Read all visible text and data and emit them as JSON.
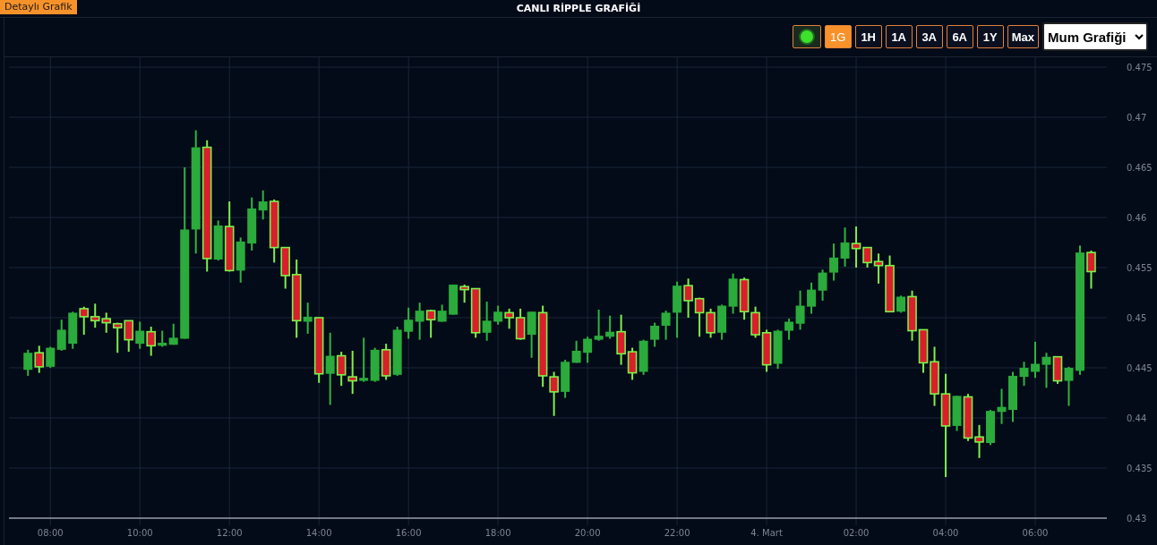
{
  "header": {
    "badge": "Detaylı Grafik",
    "title": "CANLI RİPPLE GRAFİĞİ"
  },
  "toolbar": {
    "live": {
      "on": true
    },
    "ranges": [
      {
        "label": "1G",
        "selected": true
      },
      {
        "label": "1H",
        "selected": false
      },
      {
        "label": "1A",
        "selected": false
      },
      {
        "label": "3A",
        "selected": false
      },
      {
        "label": "6A",
        "selected": false
      },
      {
        "label": "1Y",
        "selected": false
      },
      {
        "label": "Max",
        "selected": false
      }
    ],
    "chart_type": "Mum Grafiği"
  },
  "chart_data": {
    "type": "candlestick",
    "grid": true,
    "ylim": [
      0.43,
      0.475
    ],
    "yticks": [
      0.43,
      0.435,
      0.44,
      0.445,
      0.45,
      0.455,
      0.46,
      0.465,
      0.47,
      0.475
    ],
    "categories": [
      null,
      null,
      "08:00",
      null,
      null,
      null,
      null,
      null,
      null,
      null,
      "10:00",
      null,
      null,
      null,
      null,
      null,
      null,
      null,
      "12:00",
      null,
      null,
      null,
      null,
      null,
      null,
      null,
      "14:00",
      null,
      null,
      null,
      null,
      null,
      null,
      null,
      "16:00",
      null,
      null,
      null,
      null,
      null,
      null,
      null,
      "18:00",
      null,
      null,
      null,
      null,
      null,
      null,
      null,
      "20:00",
      null,
      null,
      null,
      null,
      null,
      null,
      null,
      "22:00",
      null,
      null,
      null,
      null,
      null,
      null,
      null,
      "4. Mart",
      null,
      null,
      null,
      null,
      null,
      null,
      null,
      "02:00",
      null,
      null,
      null,
      null,
      null,
      null,
      null,
      "04:00",
      null,
      null,
      null,
      null,
      null,
      null,
      null,
      "06:00",
      null,
      null,
      null,
      null,
      null
    ],
    "ohlc": [
      [
        0.4448,
        0.4468,
        0.4442,
        0.4465
      ],
      [
        0.4465,
        0.4472,
        0.4445,
        0.4451
      ],
      [
        0.4451,
        0.4471,
        0.445,
        0.447
      ],
      [
        0.4468,
        0.4498,
        0.4467,
        0.4488
      ],
      [
        0.4474,
        0.4506,
        0.4469,
        0.4505
      ],
      [
        0.4509,
        0.4511,
        0.4483,
        0.4501
      ],
      [
        0.4501,
        0.4514,
        0.449,
        0.4497
      ],
      [
        0.4499,
        0.4505,
        0.4485,
        0.4495
      ],
      [
        0.4494,
        0.4495,
        0.4465,
        0.449
      ],
      [
        0.4497,
        0.4497,
        0.4466,
        0.4478
      ],
      [
        0.4474,
        0.4496,
        0.4469,
        0.4487
      ],
      [
        0.4486,
        0.4491,
        0.4462,
        0.4472
      ],
      [
        0.4472,
        0.4487,
        0.4471,
        0.4475
      ],
      [
        0.4473,
        0.4494,
        0.4473,
        0.448
      ],
      [
        0.4479,
        0.465,
        0.4479,
        0.4588
      ],
      [
        0.4588,
        0.4687,
        0.4564,
        0.467
      ],
      [
        0.467,
        0.4677,
        0.4546,
        0.4559
      ],
      [
        0.4558,
        0.4597,
        0.4557,
        0.4592
      ],
      [
        0.4591,
        0.4616,
        0.4546,
        0.4547
      ],
      [
        0.4547,
        0.458,
        0.4535,
        0.4576
      ],
      [
        0.4574,
        0.462,
        0.4567,
        0.4609
      ],
      [
        0.4607,
        0.4627,
        0.4598,
        0.4616
      ],
      [
        0.4616,
        0.4618,
        0.4555,
        0.457
      ],
      [
        0.457,
        0.457,
        0.4529,
        0.4542
      ],
      [
        0.4543,
        0.4558,
        0.448,
        0.4497
      ],
      [
        0.4496,
        0.4515,
        0.4484,
        0.4501
      ],
      [
        0.45,
        0.45,
        0.4435,
        0.4444
      ],
      [
        0.4444,
        0.4485,
        0.4413,
        0.4462
      ],
      [
        0.4462,
        0.4466,
        0.4432,
        0.4443
      ],
      [
        0.4441,
        0.4467,
        0.4424,
        0.4437
      ],
      [
        0.4437,
        0.448,
        0.4436,
        0.444
      ],
      [
        0.4437,
        0.447,
        0.4436,
        0.4468
      ],
      [
        0.4468,
        0.4474,
        0.4438,
        0.4442
      ],
      [
        0.4443,
        0.4491,
        0.4442,
        0.4488
      ],
      [
        0.4486,
        0.451,
        0.4479,
        0.4498
      ],
      [
        0.4496,
        0.4515,
        0.4478,
        0.4507
      ],
      [
        0.4507,
        0.4508,
        0.448,
        0.4498
      ],
      [
        0.4496,
        0.4513,
        0.4496,
        0.4507
      ],
      [
        0.4503,
        0.4533,
        0.4503,
        0.4533
      ],
      [
        0.4531,
        0.4533,
        0.4515,
        0.4528
      ],
      [
        0.4529,
        0.4529,
        0.448,
        0.4485
      ],
      [
        0.4485,
        0.4516,
        0.4477,
        0.4497
      ],
      [
        0.4496,
        0.4512,
        0.4493,
        0.4506
      ],
      [
        0.4505,
        0.4509,
        0.4489,
        0.45
      ],
      [
        0.45,
        0.4509,
        0.4478,
        0.4479
      ],
      [
        0.4483,
        0.4506,
        0.446,
        0.4506
      ],
      [
        0.4505,
        0.4512,
        0.4431,
        0.4442
      ],
      [
        0.4441,
        0.4446,
        0.4402,
        0.4426
      ],
      [
        0.4426,
        0.4458,
        0.442,
        0.4456
      ],
      [
        0.4455,
        0.4477,
        0.4455,
        0.4467
      ],
      [
        0.4465,
        0.4481,
        0.4455,
        0.4479
      ],
      [
        0.4478,
        0.4508,
        0.4477,
        0.4482
      ],
      [
        0.4481,
        0.4502,
        0.4479,
        0.4486
      ],
      [
        0.4486,
        0.4503,
        0.4453,
        0.4464
      ],
      [
        0.4466,
        0.447,
        0.4438,
        0.4445
      ],
      [
        0.4446,
        0.4478,
        0.4443,
        0.4477
      ],
      [
        0.4478,
        0.4495,
        0.4471,
        0.4492
      ],
      [
        0.4492,
        0.4507,
        0.4478,
        0.4505
      ],
      [
        0.4505,
        0.4536,
        0.448,
        0.4532
      ],
      [
        0.4532,
        0.4539,
        0.45,
        0.4517
      ],
      [
        0.4519,
        0.452,
        0.4481,
        0.4505
      ],
      [
        0.4505,
        0.4509,
        0.448,
        0.4485
      ],
      [
        0.4485,
        0.4513,
        0.4478,
        0.4512
      ],
      [
        0.4511,
        0.4544,
        0.4504,
        0.4539
      ],
      [
        0.4538,
        0.454,
        0.4498,
        0.4506
      ],
      [
        0.4505,
        0.4511,
        0.448,
        0.4483
      ],
      [
        0.4485,
        0.4488,
        0.4446,
        0.4453
      ],
      [
        0.4454,
        0.4488,
        0.4449,
        0.4487
      ],
      [
        0.4487,
        0.4499,
        0.4478,
        0.4496
      ],
      [
        0.4494,
        0.4527,
        0.4488,
        0.4512
      ],
      [
        0.4511,
        0.4535,
        0.4504,
        0.4528
      ],
      [
        0.4527,
        0.4548,
        0.4517,
        0.4545
      ],
      [
        0.4545,
        0.4574,
        0.4537,
        0.456
      ],
      [
        0.4559,
        0.459,
        0.4551,
        0.4575
      ],
      [
        0.4574,
        0.4591,
        0.455,
        0.4569
      ],
      [
        0.457,
        0.457,
        0.455,
        0.4555
      ],
      [
        0.4556,
        0.4564,
        0.4534,
        0.4552
      ],
      [
        0.4552,
        0.4562,
        0.4506,
        0.4506
      ],
      [
        0.4506,
        0.4522,
        0.4505,
        0.4521
      ],
      [
        0.4521,
        0.4527,
        0.4477,
        0.4487
      ],
      [
        0.4488,
        0.4488,
        0.4445,
        0.4455
      ],
      [
        0.4456,
        0.4471,
        0.4412,
        0.4424
      ],
      [
        0.4424,
        0.4444,
        0.4341,
        0.4392
      ],
      [
        0.4392,
        0.4422,
        0.4387,
        0.4422
      ],
      [
        0.4421,
        0.4424,
        0.4377,
        0.438
      ],
      [
        0.4381,
        0.4393,
        0.436,
        0.4376
      ],
      [
        0.4375,
        0.4408,
        0.4373,
        0.4407
      ],
      [
        0.4406,
        0.4429,
        0.4394,
        0.4411
      ],
      [
        0.4408,
        0.4446,
        0.4396,
        0.4442
      ],
      [
        0.4441,
        0.4456,
        0.4432,
        0.445
      ],
      [
        0.4446,
        0.4476,
        0.444,
        0.4454
      ],
      [
        0.4453,
        0.4465,
        0.443,
        0.4461
      ],
      [
        0.4461,
        0.4461,
        0.4434,
        0.4437
      ],
      [
        0.4437,
        0.4451,
        0.4412,
        0.445
      ],
      [
        0.4447,
        0.4572,
        0.4443,
        0.4565
      ],
      [
        0.4565,
        0.4567,
        0.4529,
        0.4546
      ]
    ]
  }
}
